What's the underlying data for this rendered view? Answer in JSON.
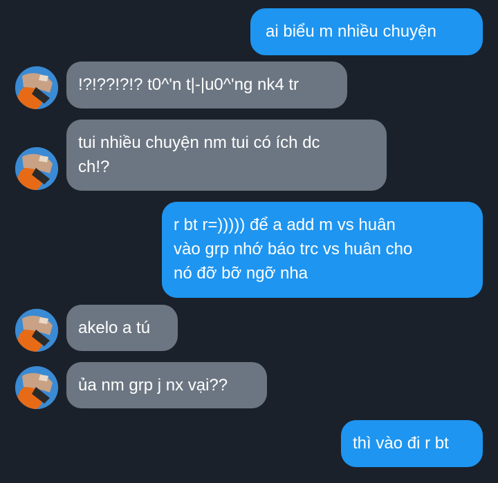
{
  "conversation": {
    "messages": [
      {
        "side": "outgoing",
        "text": "ai biểu m nhiều chuyện"
      },
      {
        "side": "incoming",
        "text": "!?!??!?!? t0^'n t|-|u0^'ng nk4 tr"
      },
      {
        "side": "incoming",
        "lines": [
          "tui nhiều chuyện nm tui có ích dc",
          "ch!?"
        ]
      },
      {
        "side": "outgoing",
        "lines": [
          "r bt r=))))) để a add m vs huân",
          "vào grp nhớ báo trc vs huân cho",
          "nó đỡ bỡ ngỡ nha"
        ]
      },
      {
        "side": "incoming",
        "text": "akelo a tú"
      },
      {
        "side": "incoming",
        "text": "ủa nm grp j nx vại??"
      },
      {
        "side": "outgoing",
        "text": "thì vào đi r bt"
      }
    ]
  },
  "colors": {
    "background": "#1a212b",
    "outgoing_bubble": "#1e95f0",
    "incoming_bubble": "#6c7682",
    "text": "#ffffff"
  },
  "icons": {
    "avatar": "contact-avatar-photo"
  }
}
